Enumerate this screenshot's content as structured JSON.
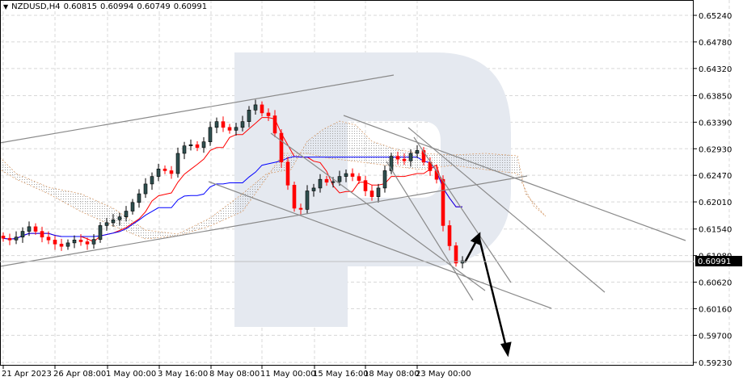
{
  "header": {
    "symbol": "NZDUSD,H4",
    "open": "0.60815",
    "high": "0.60994",
    "low": "0.60749",
    "close": "0.60991"
  },
  "chart_data": {
    "type": "candlestick",
    "title": "NZDUSD,H4",
    "ylim": [
      0.5923,
      0.6524
    ],
    "yticks": [
      "0.65240",
      "0.64780",
      "0.64320",
      "0.63850",
      "0.63390",
      "0.62930",
      "0.62470",
      "0.62010",
      "0.61540",
      "0.61080",
      "0.60620",
      "0.60160",
      "0.59700",
      "0.59230"
    ],
    "xticks": [
      "21 Apr 2023",
      "26 Apr 08:00",
      "1 May 00:00",
      "3 May 16:00",
      "8 May 08:00",
      "11 May 00:00",
      "15 May 16:00",
      "18 May 08:00",
      "23 May 00:00"
    ],
    "current_price": "0.60991",
    "closes": [
      0.6138,
      0.6135,
      0.614,
      0.615,
      0.6158,
      0.615,
      0.614,
      0.6135,
      0.6128,
      0.6124,
      0.613,
      0.6135,
      0.6132,
      0.6128,
      0.6136,
      0.616,
      0.6165,
      0.617,
      0.6175,
      0.6185,
      0.62,
      0.6215,
      0.6232,
      0.6245,
      0.6258,
      0.6255,
      0.625,
      0.6285,
      0.6298,
      0.63,
      0.6295,
      0.6305,
      0.633,
      0.634,
      0.633,
      0.6325,
      0.633,
      0.634,
      0.636,
      0.6369,
      0.6355,
      0.635,
      0.632,
      0.627,
      0.623,
      0.619,
      0.6188,
      0.622,
      0.6225,
      0.624,
      0.6235,
      0.6236,
      0.6245,
      0.625,
      0.6245,
      0.6238,
      0.622,
      0.621,
      0.6225,
      0.6255,
      0.628,
      0.6275,
      0.6272,
      0.6285,
      0.629,
      0.627,
      0.6255,
      0.624,
      0.616,
      0.6125,
      0.6095,
      0.6099
    ],
    "colors": {
      "bull": "#000000",
      "bull_body": "#2f4f4f",
      "bear": "#ff0000",
      "tenkan": "#ff0000",
      "kijun": "#0000ff",
      "cloud": "#c89060",
      "grid": "#d8d8d8",
      "watermark": "#e5e9f0"
    }
  }
}
